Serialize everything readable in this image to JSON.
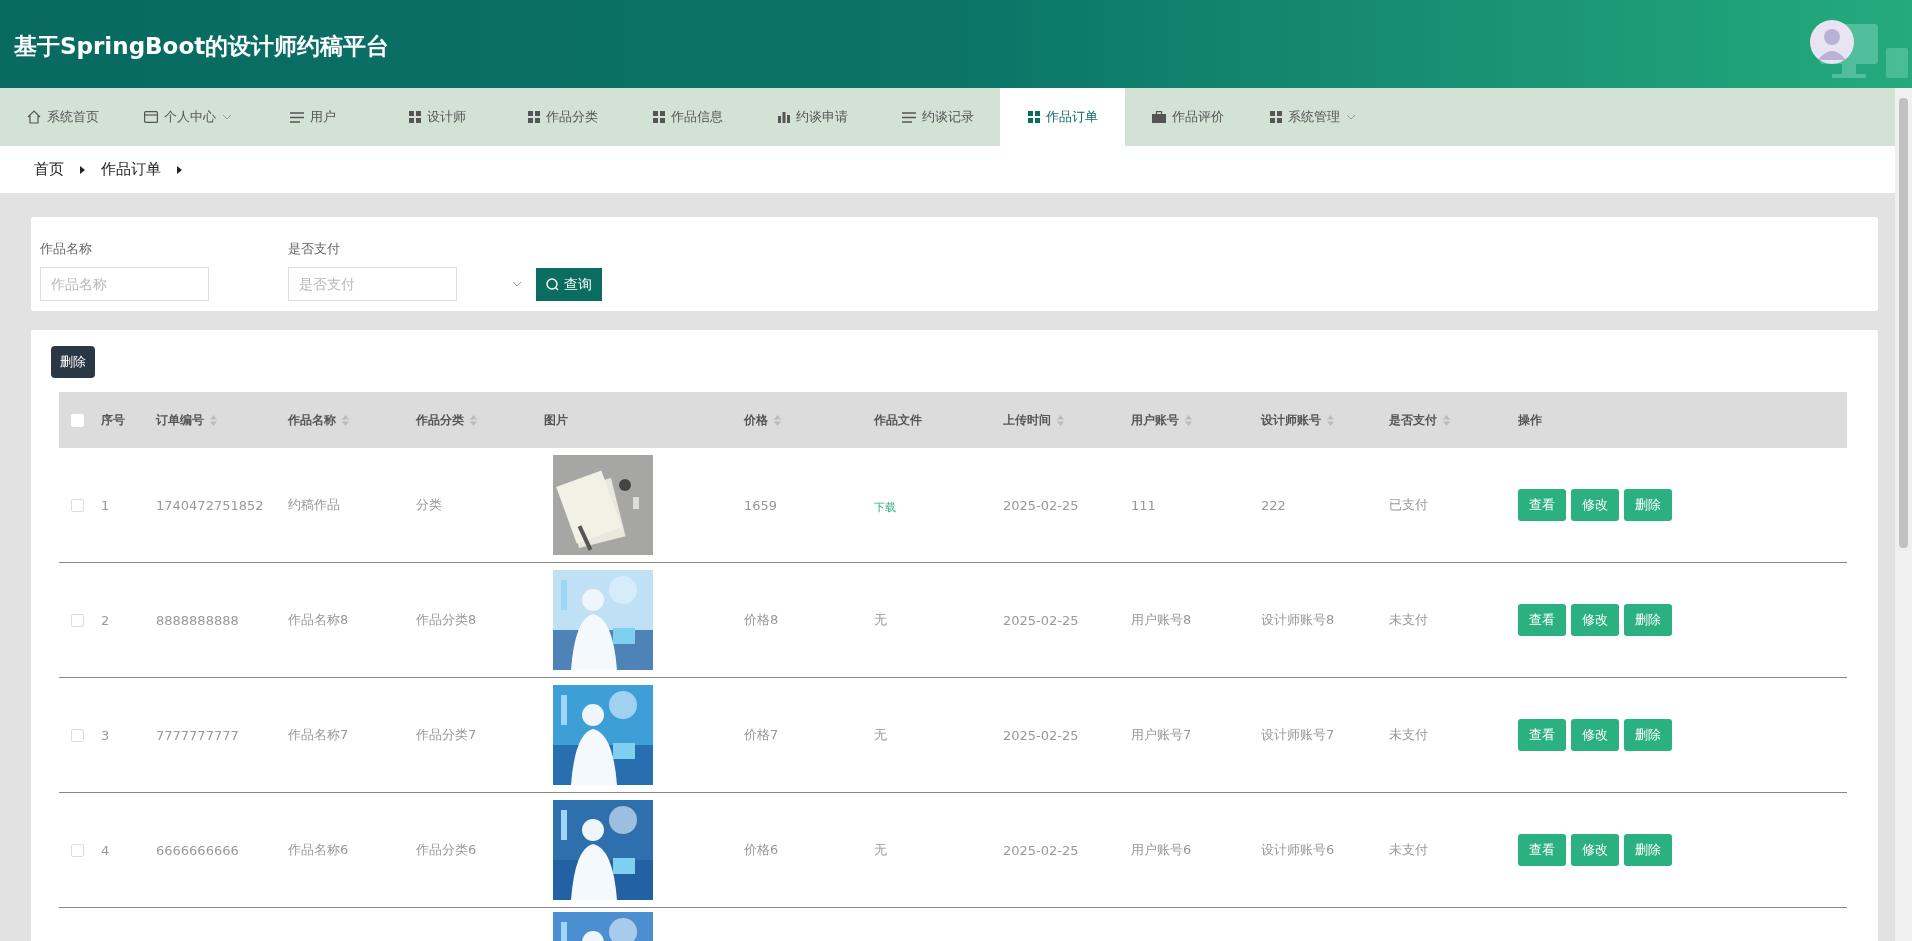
{
  "header": {
    "title": "基于SpringBoot的设计师约稿平台"
  },
  "nav": [
    {
      "label": "系统首页",
      "kind": "home",
      "dropdown": false,
      "selected": false
    },
    {
      "label": "个人中心",
      "kind": "card",
      "dropdown": true,
      "selected": false
    },
    {
      "label": "用户",
      "kind": "list",
      "dropdown": false,
      "selected": false
    },
    {
      "label": "设计师",
      "kind": "grid",
      "dropdown": false,
      "selected": false
    },
    {
      "label": "作品分类",
      "kind": "grid",
      "dropdown": false,
      "selected": false
    },
    {
      "label": "作品信息",
      "kind": "grid",
      "dropdown": false,
      "selected": false
    },
    {
      "label": "约谈申请",
      "kind": "bars",
      "dropdown": false,
      "selected": false
    },
    {
      "label": "约谈记录",
      "kind": "list",
      "dropdown": false,
      "selected": false
    },
    {
      "label": "作品订单",
      "kind": "grid",
      "dropdown": false,
      "selected": true
    },
    {
      "label": "作品评价",
      "kind": "case",
      "dropdown": false,
      "selected": false
    },
    {
      "label": "系统管理",
      "kind": "grid",
      "dropdown": true,
      "selected": false
    }
  ],
  "breadcrumb": [
    "首页",
    "作品订单"
  ],
  "search": {
    "fields": [
      {
        "label": "作品名称",
        "placeholder": "作品名称",
        "kind": "input"
      },
      {
        "label": "是否支付",
        "placeholder": "是否支付",
        "kind": "select"
      }
    ],
    "button": "查询"
  },
  "toolbar": {
    "delete_button": "删除"
  },
  "table": {
    "select_all": {
      "checked": false
    },
    "columns": [
      {
        "label": "序号",
        "sortable": false
      },
      {
        "label": "订单编号",
        "sortable": true
      },
      {
        "label": "作品名称",
        "sortable": true
      },
      {
        "label": "作品分类",
        "sortable": true
      },
      {
        "label": "图片",
        "sortable": false
      },
      {
        "label": "价格",
        "sortable": true
      },
      {
        "label": "作品文件",
        "sortable": false
      },
      {
        "label": "上传时间",
        "sortable": true
      },
      {
        "label": "用户账号",
        "sortable": true
      },
      {
        "label": "设计师账号",
        "sortable": true
      },
      {
        "label": "是否支付",
        "sortable": true
      },
      {
        "label": "操作",
        "sortable": false
      }
    ],
    "rows": [
      {
        "checked": false,
        "index": "1",
        "order_no": "1740472751852",
        "name": "约稿作品",
        "category": "分类",
        "image": {
          "kind": "picture"
        },
        "price": "1659",
        "file": {
          "kind": "link",
          "text": "下载"
        },
        "uploaded": "2025-02-25",
        "user": "111",
        "designer": "222",
        "paid": "已支付",
        "actions": [
          "查看",
          "修改",
          "删除"
        ]
      },
      {
        "checked": false,
        "index": "2",
        "order_no": "8888888888",
        "name": "作品名称8",
        "category": "作品分类8",
        "image": {
          "kind": "picture"
        },
        "price": "价格8",
        "file": {
          "kind": "text",
          "text": "无"
        },
        "uploaded": "2025-02-25",
        "user": "用户账号8",
        "designer": "设计师账号8",
        "paid": "未支付",
        "actions": [
          "查看",
          "修改",
          "删除"
        ]
      },
      {
        "checked": false,
        "index": "3",
        "order_no": "7777777777",
        "name": "作品名称7",
        "category": "作品分类7",
        "image": {
          "kind": "picture"
        },
        "price": "价格7",
        "file": {
          "kind": "text",
          "text": "无"
        },
        "uploaded": "2025-02-25",
        "user": "用户账号7",
        "designer": "设计师账号7",
        "paid": "未支付",
        "actions": [
          "查看",
          "修改",
          "删除"
        ]
      },
      {
        "checked": false,
        "index": "4",
        "order_no": "6666666666",
        "name": "作品名称6",
        "category": "作品分类6",
        "image": {
          "kind": "picture"
        },
        "price": "价格6",
        "file": {
          "kind": "text",
          "text": "无"
        },
        "uploaded": "2025-02-25",
        "user": "用户账号6",
        "designer": "设计师账号6",
        "paid": "未支付",
        "actions": [
          "查看",
          "修改",
          "删除"
        ]
      },
      {
        "image": {
          "kind": "picture"
        }
      }
    ]
  }
}
